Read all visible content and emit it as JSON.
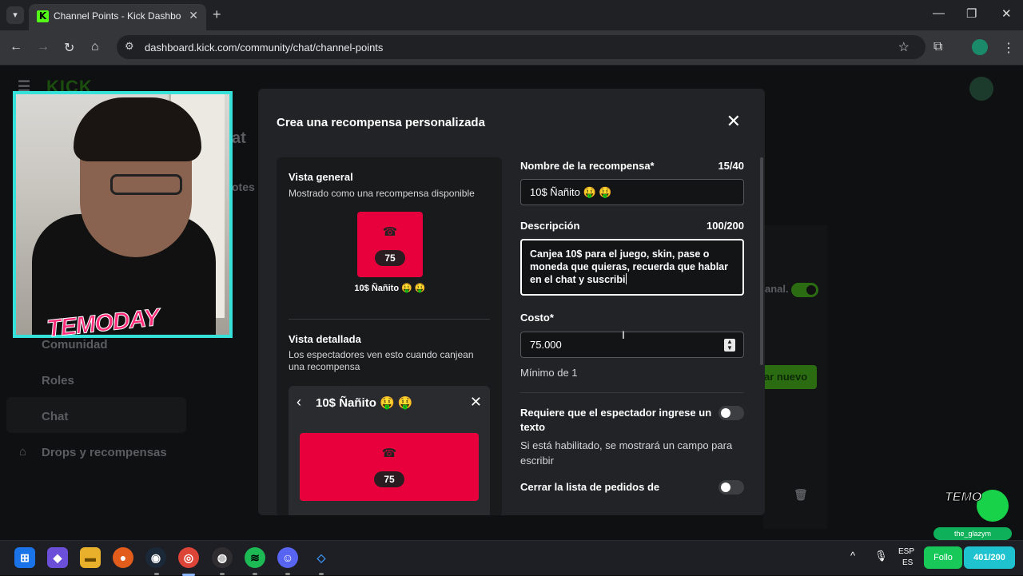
{
  "browser": {
    "tab_title": "Channel Points - Kick Dashboard",
    "url": "dashboard.kick.com/community/chat/channel-points"
  },
  "background_page": {
    "logo": "KICK",
    "heading_partial": "at",
    "tab_partial": "otes",
    "sidebar": [
      "Comunidad",
      "Roles",
      "Chat",
      "Drops y recompensas"
    ],
    "toggle_label_partial": "anal.",
    "create_button_partial": "ar nuevo"
  },
  "modal": {
    "title": "Crea una recompensa personalizada",
    "overview": {
      "heading": "Vista general",
      "subtitle": "Mostrado como una recompensa disponible",
      "cost": "75",
      "caption": "10$ Ñañito 🤑 🤑"
    },
    "detailed": {
      "heading": "Vista detallada",
      "subtitle": "Los espectadores ven esto cuando canjean una recompensa",
      "title": "10$ Ñañito 🤑 🤑",
      "cost": "75"
    },
    "form": {
      "name_label": "Nombre de la recompensa*",
      "name_count": "15/40",
      "name_value": "10$ Ñañito 🤑 🤑",
      "description_label": "Descripción",
      "description_count": "100/200",
      "description_value": "Canjea 10$ para el juego, skin, pase o moneda que quieras, recuerda que hablar en el chat y suscribi",
      "cost_label": "Costo*",
      "cost_value": "75.000",
      "cost_hint": "Mínimo de 1",
      "require_text_label": "Requiere que el espectador ingrese un texto",
      "require_text_desc": "Si está habilitado, se mostrará un campo para escribir",
      "require_text_on": false,
      "close_queue_label": "Cerrar la lista de pedidos de",
      "close_queue_on": false
    }
  },
  "overlay": {
    "streamer_logo": "TEMODAY",
    "username": "the_glazym",
    "follow": "Follo",
    "goal": "401/200"
  },
  "taskbar": {
    "lang_top": "ESP",
    "lang_bottom": "ES"
  }
}
